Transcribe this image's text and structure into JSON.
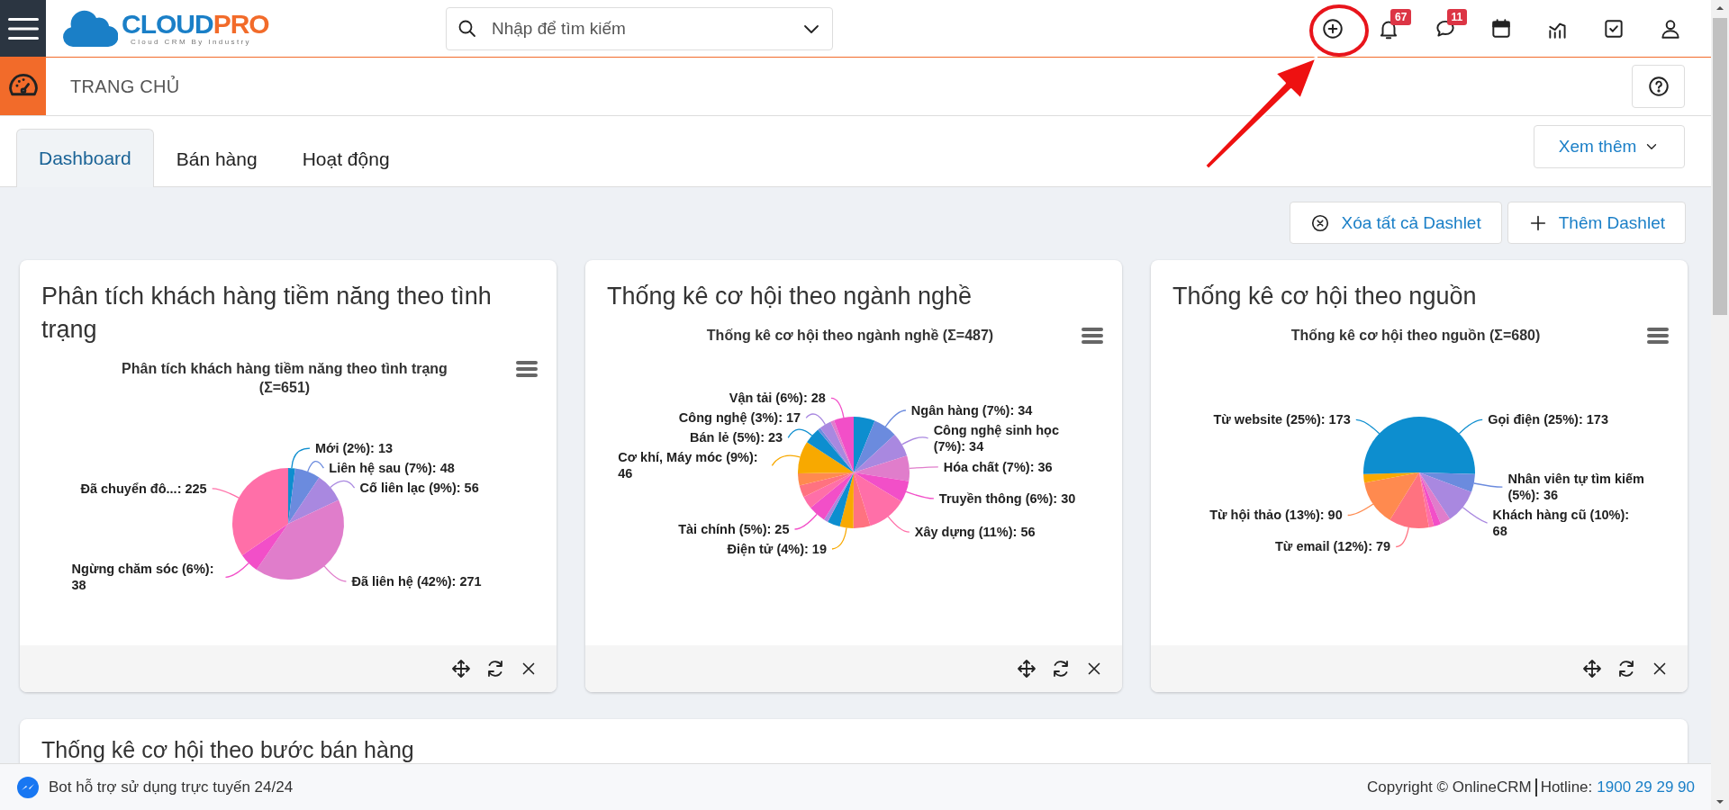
{
  "header": {
    "logo": {
      "name_first": "CLOUD",
      "name_second": "PRO",
      "tagline": "Cloud CRM By Industry"
    },
    "search": {
      "placeholder": "Nhập để tìm kiếm"
    },
    "notifications": {
      "badge": "67"
    },
    "messages": {
      "badge": "11"
    }
  },
  "page_bar": {
    "title": "TRANG CHỦ"
  },
  "tabs": [
    {
      "label": "Dashboard",
      "selected": true
    },
    {
      "label": "Bán hàng",
      "selected": false
    },
    {
      "label": "Hoạt động",
      "selected": false
    }
  ],
  "more_button": {
    "label": "Xem thêm"
  },
  "toolbar_buttons": [
    {
      "label": "Xóa tất cả Dashlet",
      "kind": "clear"
    },
    {
      "label": "Thêm Dashlet",
      "kind": "add"
    }
  ],
  "dashlets": [
    {
      "title": "Phân tích khách hàng tiềm năng theo tình trạng",
      "chart_data": {
        "type": "pie",
        "title": "Phân tích khách hàng tiềm năng theo tình trạng (Σ=651)",
        "values": [
          13,
          48,
          56,
          271,
          38,
          225
        ],
        "colors": [
          "#0d8ecf",
          "#6b8bde",
          "#a988e0",
          "#e07dcb",
          "#f24fc8",
          "#ff6fa8"
        ],
        "value_labels": [
          "Mới (2%): 13",
          "Liên hệ sau (7%): 48",
          "Cố liên lạc (9%): 56",
          "Đã liên hệ (42%): 271",
          "Ngừng chăm sóc (6%): 38",
          "Đã chuyển đô...: 225"
        ]
      }
    },
    {
      "title": "Thống kê cơ hội theo ngành nghề",
      "chart_data": {
        "type": "pie",
        "title": "Thống kê cơ hội theo ngành nghề (Σ=487)",
        "values": [
          30,
          34,
          34,
          36,
          30,
          56,
          24,
          19,
          18,
          6,
          25,
          18,
          17,
          17,
          46,
          23,
          4,
          17,
          5,
          28
        ],
        "colors": [
          "#0d8ecf",
          "#6b8bde",
          "#a988e0",
          "#e07dcb",
          "#f24fc8",
          "#ff6fa8",
          "#ff7280",
          "#f8a900",
          "#0d8ecf",
          "#a988e0",
          "#f24fc8",
          "#ff6fa8",
          "#ff7280",
          "#ff8a4f",
          "#f8a900",
          "#0d8ecf",
          "#6b8bde",
          "#a988e0",
          "#e07dcb",
          "#f24fc8"
        ],
        "value_labels": [
          null,
          "Ngân hàng (7%): 34",
          "Công nghệ sinh học (7%): 34",
          "Hóa chất (7%): 36",
          "Truyền thông (6%): 30",
          "Xây dựng (11%): 56",
          null,
          "Điện tử (4%): 19",
          null,
          null,
          "Tài chính (5%): 25",
          null,
          null,
          null,
          "Cơ khí, Máy móc (9%): 46",
          "Bán lẻ (5%): 23",
          null,
          "Công nghệ (3%): 17",
          null,
          "Vận tải (6%): 28"
        ]
      }
    },
    {
      "title": "Thống kê cơ hội theo nguồn",
      "chart_data": {
        "type": "pie",
        "title": "Thống kê cơ hội theo nguồn (Σ=680)",
        "values": [
          173,
          36,
          68,
          20,
          14,
          10,
          79,
          90,
          17,
          173
        ],
        "colors": [
          "#0d8ecf",
          "#6b8bde",
          "#a988e0",
          "#e07dcb",
          "#f24fc8",
          "#ff6fa8",
          "#ff7280",
          "#ff8a4f",
          "#f8a900",
          "#0d8ecf"
        ],
        "value_labels": [
          "Gọi điện (25%): 173",
          "Nhân viên tự tìm kiếm (5%): 36",
          "Khách hàng cũ (10%): 68",
          null,
          null,
          null,
          "Từ email (12%): 79",
          "Từ hội thảo (13%): 90",
          null,
          "Từ website (25%): 173"
        ]
      }
    }
  ],
  "partial_dashlet": {
    "title": "Thống kê cơ hội theo bước bán hàng"
  },
  "footer": {
    "chat_label": "Bot hỗ trợ sử dụng trực tuyến 24/24",
    "copyright": "Copyright © OnlineCRM",
    "hotline_label": "Hotline:",
    "hotline": "1900 29 29 90"
  }
}
